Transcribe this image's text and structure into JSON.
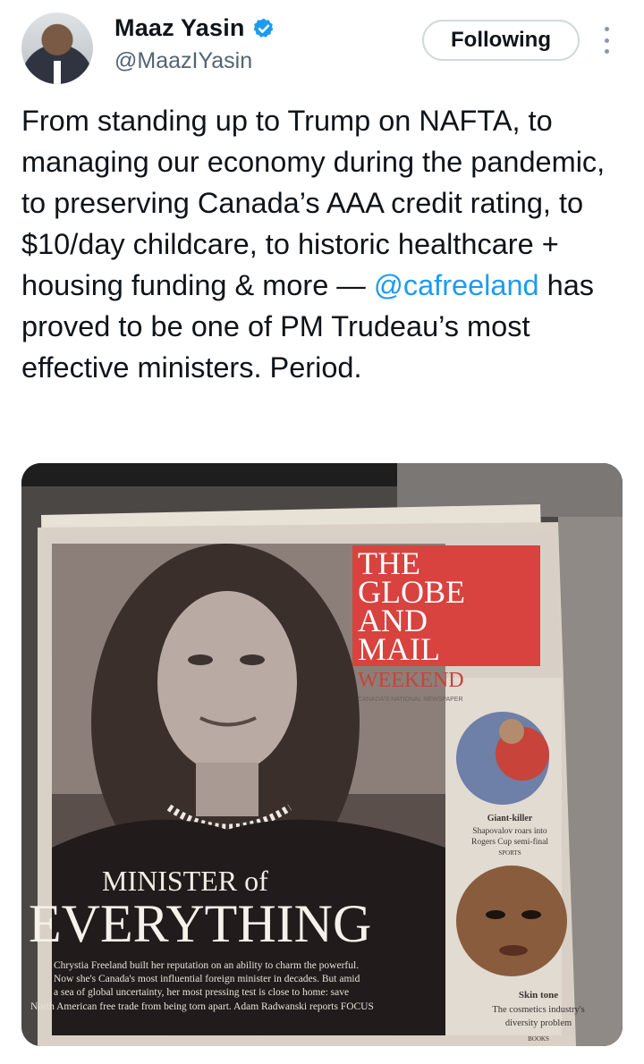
{
  "author": {
    "name": "Maaz Yasin",
    "handle": "@MaazIYasin",
    "verified_icon": "verified-badge-icon",
    "accent": "#1d9bf0"
  },
  "follow_label": "Following",
  "tweet": {
    "text_before": "From standing up to Trump on NAFTA, to managing our economy during the pandemic, to preserving Canada’s AAA credit rating, to $10/day childcare, to historic healthcare + housing funding & more — ",
    "mention": "@cafreeland",
    "text_after": " has proved to be one of PM Trudeau’s most effective ministers. Period."
  },
  "newspaper": {
    "masthead_lines": [
      "THE",
      "GLOBE",
      "AND",
      "MAIL"
    ],
    "weekend": "WEEKEND",
    "tagline": "CANADA'S NATIONAL NEWSPAPER",
    "headline_small": "MINISTER of",
    "headline_big": "EVERYTHING",
    "deck": [
      "Chrystia Freeland built her reputation on an ability to charm the powerful.",
      "Now she's Canada's most influential foreign minister in decades. But amid",
      "a sea of global uncertainty, her most pressing test is close to home: save",
      "North American free trade from being torn apart. Adam Radwanski reports FOCUS"
    ],
    "teaser1": {
      "title": "Giant-killer",
      "lines": [
        "Shapovalov roars into",
        "Rogers Cup semi-final"
      ],
      "section": "SPORTS"
    },
    "teaser2": {
      "title": "Skin tone",
      "lines": [
        "The cosmetics industry's",
        "diversity problem"
      ],
      "section": "BOOKS"
    }
  }
}
